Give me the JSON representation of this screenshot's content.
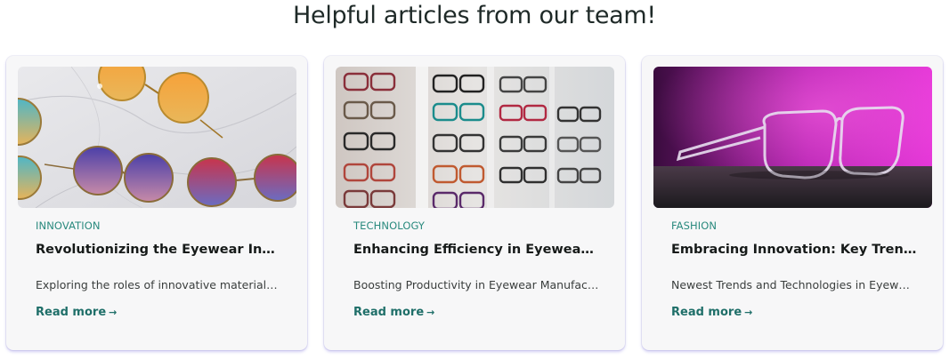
{
  "section": {
    "title": "Helpful articles from our team!"
  },
  "articles": [
    {
      "category": "INNOVATION",
      "title": "Revolutionizing the Eyewear Industry:…",
      "excerpt": "Exploring the roles of innovative materials…",
      "read_more": "Read more",
      "arrow": "→",
      "image": "colorful-round-sunglasses-on-marble"
    },
    {
      "category": "TECHNOLOGY",
      "title": "Enhancing Efficiency in Eyewear Man…",
      "excerpt": "Boosting Productivity in Eyewear Manufac…",
      "read_more": "Read more",
      "arrow": "→",
      "image": "eyeglasses-display-wall"
    },
    {
      "category": "FASHION",
      "title": "Embracing Innovation: Key Trends Sh…",
      "excerpt": "Newest Trends and Technologies in Eyew…",
      "read_more": "Read more",
      "arrow": "→",
      "image": "clear-frame-glasses-pink-background"
    }
  ],
  "colors": {
    "accent": "#2a8a7e",
    "link": "#1f6f69",
    "card_bg": "#f7f7f8"
  }
}
